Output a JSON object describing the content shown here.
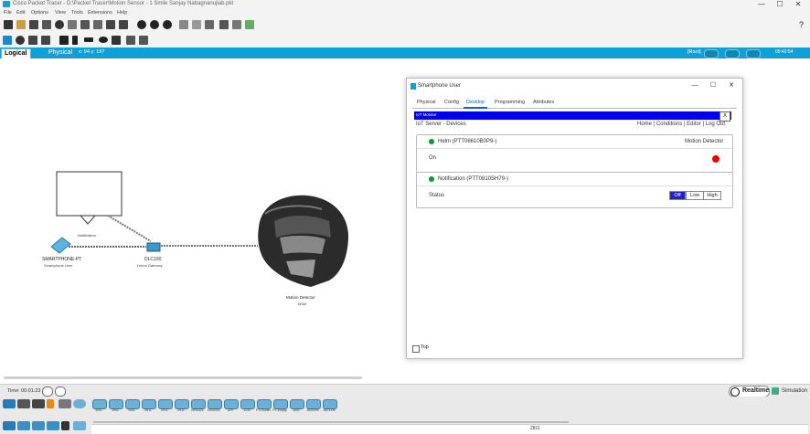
{
  "window": {
    "title": "Cisco Packet Tracer - D:\\Packet Tracer\\Motion Sensor - 1 Smile Sanjay Nabagnanujlab.pkt",
    "controls": [
      "—",
      "☐",
      "✕"
    ],
    "help_mark": "?"
  },
  "menu": [
    "File",
    "Edit",
    "Options",
    "View",
    "Tools",
    "Extensions",
    "Help"
  ],
  "topbar": {
    "logical_label": "Logical",
    "physical_label": "Physical",
    "breadcrumb": "x: 94  y: 197",
    "root_label": "[Root]",
    "clock": "09:42:54"
  },
  "workspace": {
    "note_caption": "Notification",
    "devices": [
      {
        "name": "SMARTPHONE-PT",
        "sub": "Smartphone User"
      },
      {
        "name": "DLC100",
        "sub": "Home Gateway"
      },
      {
        "name": "Motion Detector",
        "sub": "MSM"
      }
    ]
  },
  "dialog": {
    "title": "Smartphone User",
    "tabs": [
      "Physical",
      "Config",
      "Desktop",
      "Programming",
      "Attributes"
    ],
    "active_tab": 2,
    "app_header": "IoT Monitor",
    "app_close": "X",
    "path": "IoT Server - Devices",
    "nav_links": "Home | Conditions | Editor | Log Out",
    "card1": {
      "name": "Helm (PTT08610B0P9-)",
      "type": "Motion Detector",
      "row_label": "On",
      "led_color": "#e00000"
    },
    "card2": {
      "name": "Notification (PTT0810SH79-)",
      "row_label": "Status",
      "options": [
        "Off",
        "Low",
        "High"
      ],
      "selected": "Off"
    },
    "top_label": "Top"
  },
  "status": {
    "time": "Time: 00:01:23",
    "realtime": "Realtime",
    "simulation": "Simulation"
  },
  "devicebar": {
    "devices": [
      "1941",
      "1941",
      "1941",
      "2811",
      "2911",
      "2911",
      "ISR4321",
      "ISR4331",
      "829",
      "1240",
      "PT-Router",
      "PT-Empty",
      "1841",
      "2620XM",
      "2621XM",
      "2811"
    ],
    "selected_model": "2811"
  },
  "colors": {
    "accent": "#0fa0d8",
    "iot_header": "#0000e6",
    "ok_dot": "#0a9a2a"
  }
}
